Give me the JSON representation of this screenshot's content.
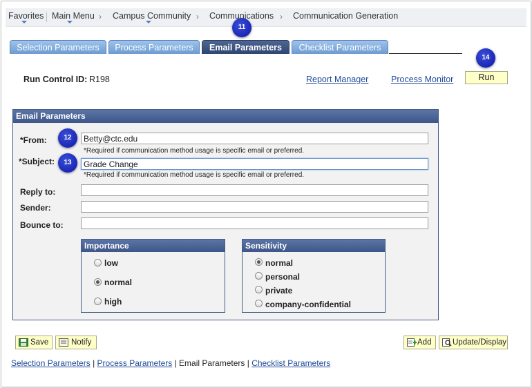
{
  "breadcrumb": {
    "favorites": "Favorites",
    "main_menu": "Main Menu",
    "campus_community": "Campus Community",
    "communications": "Communications",
    "communication_generation": "Communication Generation",
    "sep": "›"
  },
  "tabs": [
    {
      "label": "Selection Parameters",
      "active": false
    },
    {
      "label": "Process Parameters",
      "active": false
    },
    {
      "label": "Email Parameters",
      "active": true
    },
    {
      "label": "Checklist Parameters",
      "active": false
    }
  ],
  "callouts": {
    "c11": "11",
    "c12": "12",
    "c13": "13",
    "c14": "14"
  },
  "run_control": {
    "label": "Run Control ID:",
    "value": "R198"
  },
  "links": {
    "report_manager": "Report Manager",
    "process_monitor": "Process Monitor"
  },
  "run_button": "Run",
  "email_panel": {
    "title": "Email Parameters",
    "from_label": "*From:",
    "from_value": "Betty@ctc.edu",
    "from_note": "*Required if communication method usage is specific email or preferred.",
    "subject_label": "*Subject:",
    "subject_value": "Grade Change",
    "subject_note": "*Required if communication method usage is specific email or preferred.",
    "reply_label": "Reply to:",
    "reply_value": "",
    "sender_label": "Sender:",
    "sender_value": "",
    "bounce_label": "Bounce to:",
    "bounce_value": ""
  },
  "importance": {
    "title": "Importance",
    "options": [
      "low",
      "normal",
      "high"
    ],
    "selected": "normal"
  },
  "sensitivity": {
    "title": "Sensitivity",
    "options": [
      "normal",
      "personal",
      "private",
      "company-confidential"
    ],
    "selected": "normal"
  },
  "buttons": {
    "save": "Save",
    "notify": "Notify",
    "add": "Add",
    "update_display": "Update/Display"
  },
  "bottom_links": {
    "selection": "Selection Parameters",
    "process": "Process Parameters",
    "email": "Email Parameters",
    "checklist": "Checklist Parameters",
    "sep": " | "
  },
  "colors": {
    "tab_active": "#2f4673",
    "tab_inactive": "#7fa9dc",
    "callout": "#0b16a8",
    "button_bg": "#ffffc8"
  }
}
